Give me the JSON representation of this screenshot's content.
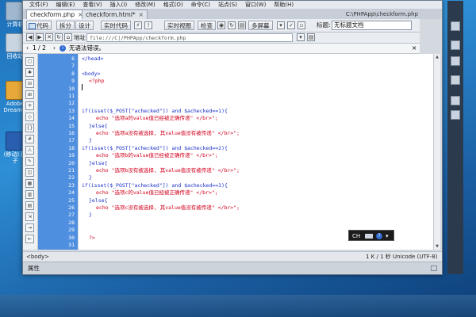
{
  "desktop": {
    "icons": [
      {
        "label": "计算机",
        "icon": "computer-icon"
      },
      {
        "label": "回收站",
        "icon": "recycle-bin-icon"
      },
      {
        "label": "Adobe Dreamw",
        "icon": "dreamweaver-icon"
      },
      {
        "label": "(移动) 陈子",
        "icon": "word-document-icon"
      }
    ]
  },
  "menu": [
    "文件(F)",
    "编辑(E)",
    "查看(V)",
    "插入(I)",
    "修改(M)",
    "格式(O)",
    "命令(C)",
    "站点(S)",
    "窗口(W)",
    "帮助(H)"
  ],
  "tabs": [
    {
      "label": "checkform.php",
      "active": true
    },
    {
      "label": "checkform.html*",
      "active": false
    }
  ],
  "file_path": "C:\\PHPApp\\checkform.php",
  "toolbar": {
    "code": "代码",
    "split": "拆分",
    "design": "设计",
    "live_code": "实时代码",
    "live_view": "实时视图",
    "inspect": "检查",
    "multi_screen": "多屏幕",
    "title_label": "标题:",
    "title_value": "无标题文档"
  },
  "address": {
    "label": "地址:",
    "value": "file:///C|/PHPApp/checkform.php"
  },
  "info": {
    "page": "1 / 2",
    "message": "无语法错误。"
  },
  "code_lines": [
    {
      "n": "6",
      "text": "</head>",
      "color": "#1a2fc9",
      "indent": 0
    },
    {
      "n": "7",
      "text": "",
      "color": "#000",
      "indent": 0
    },
    {
      "n": "8",
      "text": "<body>",
      "color": "#1a2fc9",
      "indent": 0
    },
    {
      "n": "9",
      "text": "<?php",
      "color": "#d2001c",
      "indent": 1
    },
    {
      "n": "10",
      "text": "",
      "color": "#000",
      "indent": 0
    },
    {
      "n": "11",
      "text": "",
      "color": "#000",
      "indent": 0
    },
    {
      "n": "12",
      "text": "",
      "color": "#000",
      "indent": 0
    },
    {
      "n": "13",
      "text": "if(isset($_POST[\"achecked\"]) and $achecked==1){",
      "color": "#1a2fc9",
      "indent": 0
    },
    {
      "n": "14",
      "text": "echo \"选项a的value值已经被正确传递\" </br>\";",
      "color": "#d2001c",
      "indent": 2
    },
    {
      "n": "15",
      "text": "}else{",
      "color": "#1a2fc9",
      "indent": 1
    },
    {
      "n": "16",
      "text": "echo \"选项a没有被选择, 其value值没有被传递\" </br>\";",
      "color": "#d2001c",
      "indent": 2
    },
    {
      "n": "17",
      "text": "}",
      "color": "#1a2fc9",
      "indent": 1
    },
    {
      "n": "18",
      "text": "if(isset($_POST[\"achecked\"]) and $achecked==2){",
      "color": "#1a2fc9",
      "indent": 0
    },
    {
      "n": "19",
      "text": "echo \"选项b的value值已经被正确传递\" </br>\";",
      "color": "#d2001c",
      "indent": 2
    },
    {
      "n": "20",
      "text": "}else{",
      "color": "#1a2fc9",
      "indent": 1
    },
    {
      "n": "21",
      "text": "echo \"选项b没有被选择, 其value值没有被传递\" </br>\";",
      "color": "#d2001c",
      "indent": 2
    },
    {
      "n": "22",
      "text": "}",
      "color": "#1a2fc9",
      "indent": 1
    },
    {
      "n": "23",
      "text": "if(isset($_POST[\"achecked\"]) and $achecked==3){",
      "color": "#1a2fc9",
      "indent": 0
    },
    {
      "n": "24",
      "text": "echo \"选项c的value值已经被正确传递\" </br>\";",
      "color": "#d2001c",
      "indent": 2
    },
    {
      "n": "25",
      "text": "}else{",
      "color": "#1a2fc9",
      "indent": 1
    },
    {
      "n": "26",
      "text": "echo \"选项c没有被选择, 其value值没有被传递\" </br>\";",
      "color": "#d2001c",
      "indent": 2
    },
    {
      "n": "27",
      "text": "}",
      "color": "#1a2fc9",
      "indent": 1
    },
    {
      "n": "28",
      "text": "",
      "color": "#000",
      "indent": 0
    },
    {
      "n": "29",
      "text": "",
      "color": "#000",
      "indent": 0
    },
    {
      "n": "30",
      "text": "?>",
      "color": "#d2001c",
      "indent": 1
    },
    {
      "n": "31",
      "text": "",
      "color": "#000",
      "indent": 0
    }
  ],
  "status": {
    "tag": "<body>",
    "info": "1 K / 1 秒 Unicode (UTF-8)"
  },
  "properties": {
    "label": "属性"
  },
  "toast": {
    "label": "CH"
  }
}
